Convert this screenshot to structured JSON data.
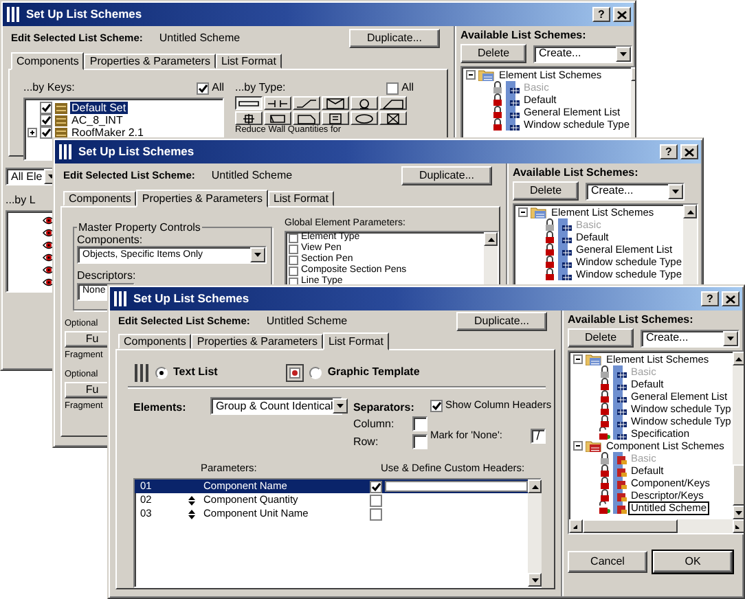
{
  "windows": [
    {
      "kind": "components",
      "title": "Set Up List Schemes",
      "help_button": "?",
      "edit_label": "Edit Selected List Scheme:",
      "scheme_name": "Untitled Scheme",
      "duplicate_button": "Duplicate...",
      "tabs": [
        {
          "label": "Components",
          "selected": true
        },
        {
          "label": "Properties & Parameters",
          "selected": false
        },
        {
          "label": "List Format",
          "selected": false
        }
      ],
      "by_keys": {
        "label": "...by Keys:",
        "all_label": "All",
        "all_checked": true,
        "items": [
          {
            "label": "Default Set",
            "checked": true,
            "expandable": false,
            "selected": true
          },
          {
            "label": "AC_8_INT",
            "checked": true,
            "expandable": false,
            "selected": false
          },
          {
            "label": "RoofMaker 2.1",
            "checked": true,
            "expandable": true,
            "selected": false
          }
        ]
      },
      "by_type": {
        "label": "...by Type:",
        "all_label": "All",
        "all_checked": false,
        "types": [
          {
            "selected": true
          },
          {
            "selected": false
          },
          {
            "selected": false
          },
          {
            "selected": false
          },
          {
            "selected": false
          },
          {
            "selected": false
          },
          {
            "selected": false
          },
          {
            "selected": false
          },
          {
            "selected": false
          },
          {
            "selected": false
          },
          {
            "selected": false
          },
          {
            "selected": false
          }
        ]
      },
      "reduce_label": "Reduce Wall Quantities for",
      "layer_filter": {
        "value": "All Ele",
        "label": "...by L"
      },
      "available": {
        "label": "Available List Schemes:",
        "delete_button": "Delete",
        "create_value": "Create...",
        "tree": [
          {
            "label": "Element List Schemes",
            "kind": "element",
            "expanded": true,
            "children": [
              {
                "label": "Basic",
                "locked": true,
                "disabled": true,
                "selected": false
              },
              {
                "label": "Default",
                "locked": true,
                "disabled": false,
                "selected": false
              },
              {
                "label": "General Element List",
                "locked": true,
                "disabled": false,
                "selected": false
              },
              {
                "label": "Window schedule Type",
                "locked": true,
                "disabled": false,
                "selected": false
              }
            ]
          }
        ]
      }
    },
    {
      "kind": "properties",
      "title": "Set Up List Schemes",
      "help_button": "?",
      "edit_label": "Edit Selected List Scheme:",
      "scheme_name": "Untitled Scheme",
      "duplicate_button": "Duplicate...",
      "tabs": [
        {
          "label": "Components",
          "selected": false
        },
        {
          "label": "Properties & Parameters",
          "selected": true
        },
        {
          "label": "List Format",
          "selected": false
        }
      ],
      "master_controls": {
        "title": "Master Property Controls",
        "components_label": "Components:",
        "components_value": "Objects, Specific Items Only",
        "descriptors_label": "Descriptors:",
        "descriptors_value": "None"
      },
      "optional_groups": [
        {
          "label": "Optional",
          "button": "Fu",
          "note": "Fragment"
        },
        {
          "label": "Optional",
          "button": "Fu",
          "note": "Fragment"
        }
      ],
      "global_parameters": {
        "label": "Global Element Parameters:",
        "items": [
          {
            "label": "Element Type",
            "checked": false
          },
          {
            "label": "View Pen",
            "checked": false
          },
          {
            "label": "Section Pen",
            "checked": false
          },
          {
            "label": "Composite Section Pens",
            "checked": false
          },
          {
            "label": "Line Type",
            "checked": false
          }
        ]
      },
      "available": {
        "label": "Available List Schemes:",
        "delete_button": "Delete",
        "create_value": "Create...",
        "tree": [
          {
            "label": "Element List Schemes",
            "kind": "element",
            "expanded": true,
            "children": [
              {
                "label": "Basic",
                "locked": true,
                "disabled": true,
                "selected": false
              },
              {
                "label": "Default",
                "locked": true,
                "disabled": false,
                "selected": false
              },
              {
                "label": "General Element List",
                "locked": true,
                "disabled": false,
                "selected": false
              },
              {
                "label": "Window schedule Type",
                "locked": true,
                "disabled": false,
                "selected": false
              },
              {
                "label": "Window schedule Type",
                "locked": true,
                "disabled": false,
                "selected": false
              }
            ]
          }
        ]
      }
    },
    {
      "kind": "list_format",
      "title": "Set Up List Schemes",
      "help_button": "?",
      "edit_label": "Edit Selected List Scheme:",
      "scheme_name": "Untitled Scheme",
      "duplicate_button": "Duplicate...",
      "tabs": [
        {
          "label": "Components",
          "selected": false
        },
        {
          "label": "Properties & Parameters",
          "selected": false
        },
        {
          "label": "List Format",
          "selected": true
        }
      ],
      "format": {
        "options": [
          {
            "kind": "text",
            "label": "Text List",
            "selected": true
          },
          {
            "kind": "graphic",
            "label": "Graphic Template",
            "selected": false
          }
        ],
        "elements_label": "Elements:",
        "elements_value": "Group & Count Identical",
        "separators_label": "Separators:",
        "column_label": "Column:",
        "row_label": "Row:",
        "show_headers": {
          "label": "Show Column Headers",
          "checked": true
        },
        "mark_label": "Mark for 'None':",
        "mark_value": "/",
        "parameters_label": "Parameters:",
        "custom_headers_label": "Use & Define Custom Headers:",
        "parameters": [
          {
            "number": "01",
            "name": "Component Name",
            "custom_header": true,
            "selected": true
          },
          {
            "number": "02",
            "name": "Component Quantity",
            "custom_header": false,
            "selected": false
          },
          {
            "number": "03",
            "name": "Component Unit Name",
            "custom_header": false,
            "selected": false
          }
        ]
      },
      "available": {
        "label": "Available List Schemes:",
        "delete_button": "Delete",
        "create_value": "Create...",
        "tree": [
          {
            "label": "Element List Schemes",
            "kind": "element",
            "expanded": true,
            "children": [
              {
                "label": "Basic",
                "locked": true,
                "disabled": true,
                "selected": false
              },
              {
                "label": "Default",
                "locked": true,
                "disabled": false,
                "selected": false
              },
              {
                "label": "General Element List",
                "locked": true,
                "disabled": false,
                "selected": false
              },
              {
                "label": "Window schedule Typ",
                "locked": true,
                "disabled": false,
                "selected": false
              },
              {
                "label": "Window schedule Typ",
                "locked": true,
                "disabled": false,
                "selected": false
              },
              {
                "label": "Specification",
                "locked": false,
                "disabled": false,
                "selected": false
              }
            ]
          },
          {
            "label": "Component List Schemes",
            "kind": "component",
            "expanded": true,
            "children": [
              {
                "label": "Basic",
                "locked": true,
                "disabled": true,
                "selected": false
              },
              {
                "label": "Default",
                "locked": true,
                "disabled": false,
                "selected": false
              },
              {
                "label": "Component/Keys",
                "locked": true,
                "disabled": false,
                "selected": false
              },
              {
                "label": "Descriptor/Keys",
                "locked": true,
                "disabled": false,
                "selected": false
              },
              {
                "label": "Untitled Scheme",
                "locked": false,
                "disabled": false,
                "selected": true
              }
            ]
          }
        ]
      },
      "buttons": [
        {
          "label": "Cancel",
          "default": false
        },
        {
          "label": "OK",
          "default": true
        }
      ]
    }
  ]
}
